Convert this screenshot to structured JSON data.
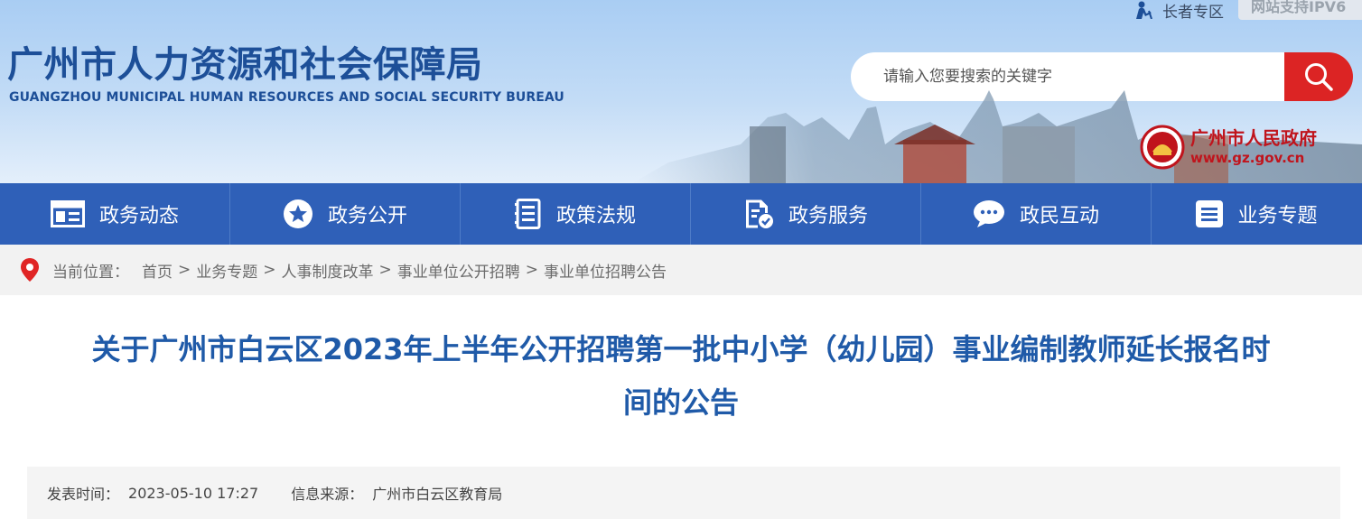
{
  "header": {
    "elder_link": "长者专区",
    "ipv6_badge": "网站支持IPV6",
    "logo_cn": "广州市人力资源和社会保障局",
    "logo_en": "GUANGZHOU MUNICIPAL HUMAN RESOURCES AND SOCIAL SECURITY BUREAU",
    "search": {
      "placeholder": "请输入您要搜索的关键字"
    },
    "gov_name": "广州市人民政府",
    "gov_url": "www.gz.gov.cn"
  },
  "nav": {
    "items": [
      {
        "label": "政务动态",
        "icon": "newspaper-icon"
      },
      {
        "label": "政务公开",
        "icon": "star-circle-icon"
      },
      {
        "label": "政策法规",
        "icon": "document-list-icon"
      },
      {
        "label": "政务服务",
        "icon": "service-doc-icon"
      },
      {
        "label": "政民互动",
        "icon": "chat-bubble-icon"
      },
      {
        "label": "业务专题",
        "icon": "list-box-icon"
      }
    ]
  },
  "breadcrumb": {
    "label": "当前位置：",
    "items": [
      "首页",
      "业务专题",
      "人事制度改革",
      "事业单位公开招聘",
      "事业单位招聘公告"
    ],
    "separator": ">"
  },
  "article": {
    "title_line1": "关于广州市白云区2023年上半年公开招聘第一批中小学（幼儿园）事业编制教师延长报名时",
    "title_line2": "间的公告",
    "publish_label": "发表时间：",
    "publish_time": "2023-05-10 17:27",
    "source_label": "信息来源：",
    "source": "广州市白云区教育局"
  },
  "colors": {
    "nav_bg": "#2f60b8",
    "title": "#1f5aa8",
    "search_button": "#dc2424",
    "gov_red": "#c0141c"
  }
}
